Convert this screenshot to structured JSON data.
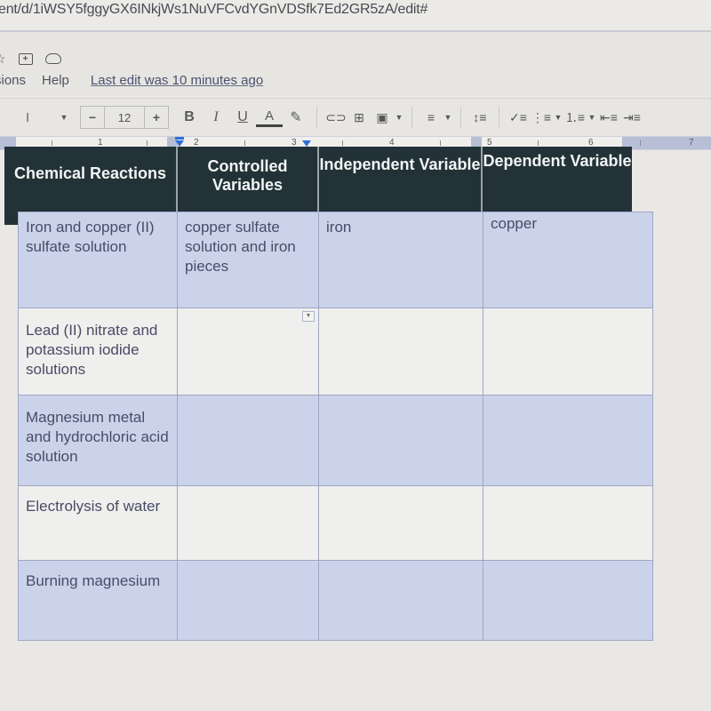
{
  "browser": {
    "url": "ent/d/1iWSY5fggyGX6INkjWs1NuVFCvdYGnVDSfk7Ed2GR5zA/edit#"
  },
  "doc_header": {
    "icons": [
      "star-icon",
      "move-to-folder-icon",
      "cloud-saved-icon"
    ],
    "menu_items": [
      "sions",
      "Help"
    ],
    "last_edit": "Last edit was 10 minutes ago"
  },
  "toolbar": {
    "font_name": "l",
    "font_size": "12",
    "minus": "−",
    "plus": "+",
    "bold": "B",
    "italic": "I",
    "underline": "U",
    "text_color": "A",
    "highlight": "✎",
    "link": "⊂⊃",
    "comment": "⊞",
    "image": "▣",
    "align": "≡",
    "line_spacing": "↕≡",
    "checklist": "✓≡",
    "bulleted_list": "⋮≡",
    "numbered_list": "⒈≡",
    "decrease_indent": "⇤≡",
    "increase_indent": "⇥≡"
  },
  "ruler": {
    "numbers": [
      "1",
      "2",
      "3",
      "4",
      "5",
      "6",
      "7"
    ]
  },
  "table": {
    "headers": [
      "Chemical Reactions",
      "Controlled Variables",
      "Independent Variable",
      "Dependent Variable"
    ],
    "rows": [
      [
        "Iron and copper (II) sulfate solution",
        "copper sulfate solution and iron pieces",
        "iron",
        "copper"
      ],
      [
        "Lead (II) nitrate and potassium iodide solutions",
        "",
        "",
        ""
      ],
      [
        "Magnesium metal and hydrochloric acid solution",
        "",
        "",
        ""
      ],
      [
        "Electrolysis of water",
        "",
        "",
        ""
      ],
      [
        "Burning magnesium",
        "",
        "",
        ""
      ]
    ]
  },
  "colors": {
    "header_bg": "#223236",
    "row_shade": "#cbd3ea",
    "row_plain": "#efefed",
    "accent_blue": "#2f6fd8"
  }
}
